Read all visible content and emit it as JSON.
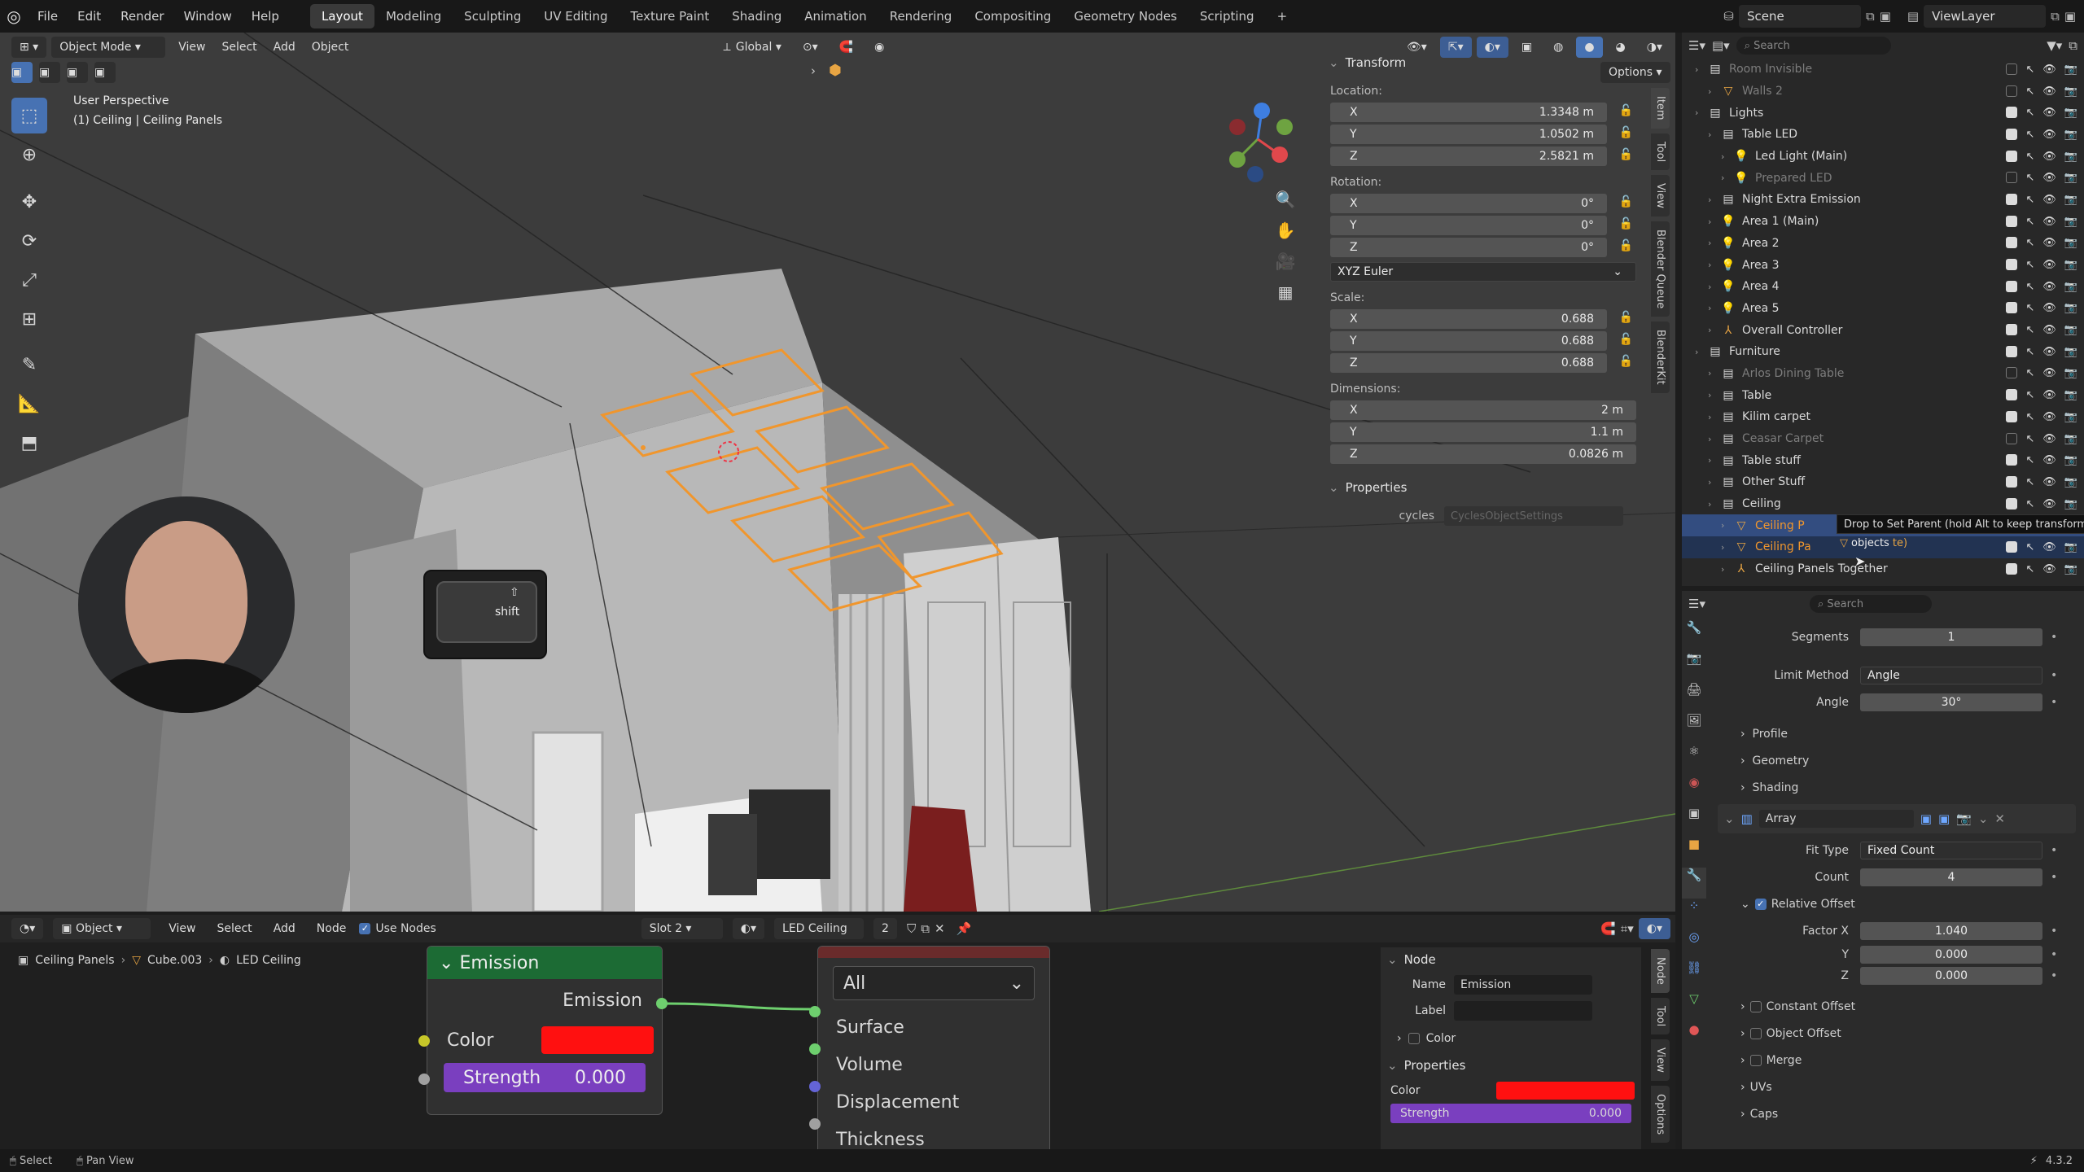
{
  "topbar": {
    "menus": [
      "File",
      "Edit",
      "Render",
      "Window",
      "Help"
    ],
    "workspaces": [
      "Layout",
      "Modeling",
      "Sculpting",
      "UV Editing",
      "Texture Paint",
      "Shading",
      "Animation",
      "Rendering",
      "Compositing",
      "Geometry Nodes",
      "Scripting"
    ],
    "active_workspace": "Layout",
    "scene": "Scene",
    "view_layer": "ViewLayer"
  },
  "viewport": {
    "mode": "Object Mode",
    "menus": [
      "View",
      "Select",
      "Add",
      "Object"
    ],
    "orientation": "Global",
    "options": "Options",
    "overlay_title": "User Perspective",
    "overlay_sub": "(1) Ceiling | Ceiling Panels",
    "key_hint": "shift"
  },
  "npanel": {
    "transform_title": "Transform",
    "location_label": "Location:",
    "location": [
      {
        "axis": "X",
        "value": "1.3348 m"
      },
      {
        "axis": "Y",
        "value": "1.0502 m"
      },
      {
        "axis": "Z",
        "value": "2.5821 m"
      }
    ],
    "rotation_label": "Rotation:",
    "rotation": [
      {
        "axis": "X",
        "value": "0°"
      },
      {
        "axis": "Y",
        "value": "0°"
      },
      {
        "axis": "Z",
        "value": "0°"
      }
    ],
    "rotation_mode": "XYZ Euler",
    "scale_label": "Scale:",
    "scale": [
      {
        "axis": "X",
        "value": "0.688"
      },
      {
        "axis": "Y",
        "value": "0.688"
      },
      {
        "axis": "Z",
        "value": "0.688"
      }
    ],
    "dimensions_label": "Dimensions:",
    "dimensions": [
      {
        "axis": "X",
        "value": "2 m"
      },
      {
        "axis": "Y",
        "value": "1.1 m"
      },
      {
        "axis": "Z",
        "value": "0.0826 m"
      }
    ],
    "properties_title": "Properties",
    "cycles_label": "cycles",
    "cycles_value": "CyclesObjectSettings",
    "tabs": [
      "Item",
      "Tool",
      "View",
      "Blender Queue",
      "BlenderKit"
    ]
  },
  "outliner": {
    "search_placeholder": "Search",
    "rows": [
      {
        "label": "Room Invisible",
        "indent": 1,
        "icon": "collection",
        "dim": true
      },
      {
        "label": "Walls 2",
        "indent": 2,
        "icon": "mesh",
        "dim": true
      },
      {
        "label": "Lights",
        "indent": 1,
        "icon": "collection"
      },
      {
        "label": "Table LED",
        "indent": 2,
        "icon": "collection"
      },
      {
        "label": "Led Light (Main)",
        "indent": 3,
        "icon": "light"
      },
      {
        "label": "Prepared LED",
        "indent": 3,
        "icon": "light",
        "dim": true
      },
      {
        "label": "Night Extra Emission",
        "indent": 2,
        "icon": "collection"
      },
      {
        "label": "Area 1 (Main)",
        "indent": 2,
        "icon": "light"
      },
      {
        "label": "Area 2",
        "indent": 2,
        "icon": "light"
      },
      {
        "label": "Area 3",
        "indent": 2,
        "icon": "light"
      },
      {
        "label": "Area 4",
        "indent": 2,
        "icon": "light"
      },
      {
        "label": "Area 5",
        "indent": 2,
        "icon": "light"
      },
      {
        "label": "Overall Controller",
        "indent": 2,
        "icon": "empty"
      },
      {
        "label": "Furniture",
        "indent": 1,
        "icon": "collection"
      },
      {
        "label": "Arlos Dining Table",
        "indent": 2,
        "icon": "collection",
        "dim": true
      },
      {
        "label": "Table",
        "indent": 2,
        "icon": "collection"
      },
      {
        "label": "Kilim carpet",
        "indent": 2,
        "icon": "collection"
      },
      {
        "label": "Ceasar Carpet",
        "indent": 2,
        "icon": "collection",
        "dim": true
      },
      {
        "label": "Table stuff",
        "indent": 2,
        "icon": "collection"
      },
      {
        "label": "Other Stuff",
        "indent": 2,
        "icon": "collection"
      },
      {
        "label": "Ceiling",
        "indent": 2,
        "icon": "collection"
      },
      {
        "label": "Ceiling P",
        "indent": 3,
        "icon": "mesh",
        "selected": true
      },
      {
        "label": "Ceiling Pa",
        "indent": 3,
        "icon": "mesh",
        "highlight": true
      },
      {
        "label": "Ceiling Panels Together",
        "indent": 3,
        "icon": "empty"
      }
    ],
    "tooltip": "Drop to Set Parent (hold Alt to keep transforms)",
    "drag_label": "objects",
    "drag_suffix": "te)"
  },
  "properties": {
    "search_placeholder": "Search",
    "segments_label": "Segments",
    "segments": "1",
    "limit_method_label": "Limit Method",
    "limit_method": "Angle",
    "angle_label": "Angle",
    "angle": "30°",
    "sections": [
      "Profile",
      "Geometry",
      "Shading"
    ],
    "modifier_name": "Array",
    "fit_type_label": "Fit Type",
    "fit_type": "Fixed Count",
    "count_label": "Count",
    "count": "4",
    "relative_offset": "Relative Offset",
    "factor_x_label": "Factor X",
    "factor_x": "1.040",
    "factor_y_label": "Y",
    "factor_y": "0.000",
    "factor_z_label": "Z",
    "factor_z": "0.000",
    "subpanels": [
      "Constant Offset",
      "Object Offset",
      "Merge",
      "UVs",
      "Caps"
    ]
  },
  "node_editor": {
    "type": "Object",
    "menus": [
      "View",
      "Select",
      "Add",
      "Node"
    ],
    "use_nodes": "Use Nodes",
    "slot": "Slot 2",
    "material": "LED Ceiling",
    "users": "2",
    "breadcrumb": [
      "Ceiling Panels",
      "Cube.003",
      "LED Ceiling"
    ],
    "emission_node": {
      "title": "Emission",
      "output": "Emission",
      "color_label": "Color",
      "strength_label": "Strength",
      "strength": "0.000"
    },
    "output_node": {
      "target": "All",
      "inputs": [
        "Surface",
        "Volume",
        "Displacement",
        "Thickness"
      ]
    },
    "side": {
      "node_title": "Node",
      "name_label": "Name",
      "name": "Emission",
      "label_label": "Label",
      "color_label": "Color",
      "properties_title": "Properties",
      "prop_color_label": "Color",
      "prop_strength_label": "Strength",
      "prop_strength": "0.000",
      "tabs": [
        "Node",
        "Tool",
        "View",
        "Options"
      ]
    }
  },
  "status": {
    "select": "Select",
    "pan": "Pan View",
    "version": "4.3.2"
  },
  "colors": {
    "accent": "#4772b3",
    "emission_red": "#ff1010",
    "strength_purple": "#7a3fbf",
    "node_header_green": "#1c6b34",
    "selection_orange": "#f0962d"
  }
}
